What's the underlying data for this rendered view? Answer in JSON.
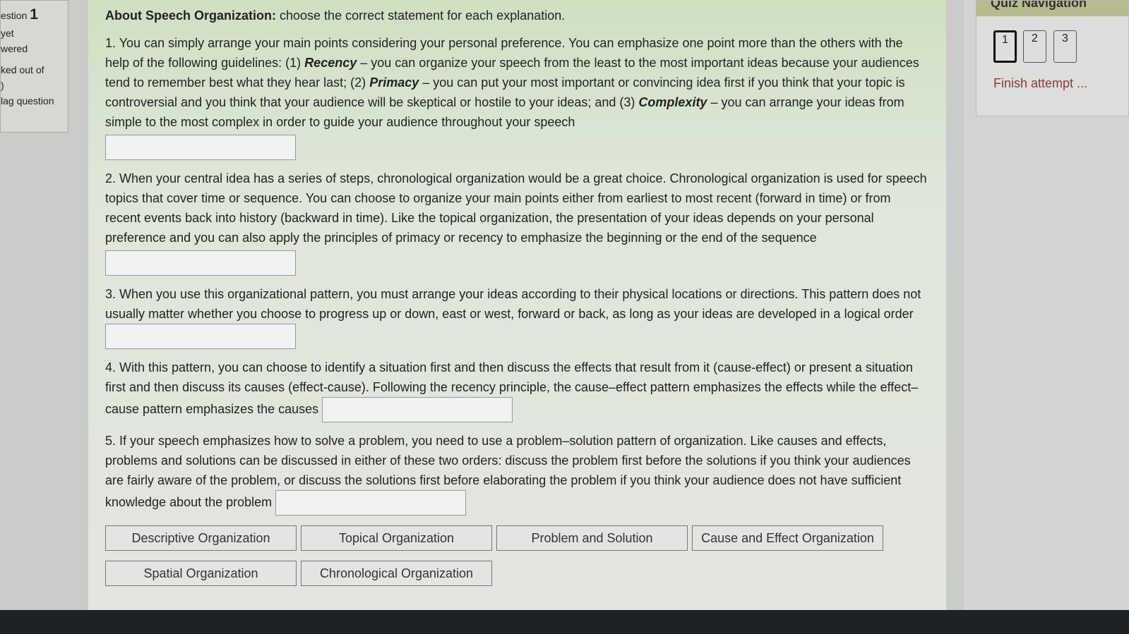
{
  "sidebar": {
    "question_label": "estion",
    "question_number": "1",
    "status_line1": "yet",
    "status_line2": "wered",
    "marked_line1": "ked out of",
    "marked_line2": ")",
    "flag": "lag question"
  },
  "main": {
    "intro_bold": "About Speech Organization:",
    "intro_rest": " choose the correct statement for each explanation.",
    "q1": {
      "a": "1. You can simply arrange your main points considering your personal preference. You can emphasize one point more than the others with the help of the following guidelines: (1) ",
      "t1": "Recency",
      "b": " – you can organize your speech from the least to the most important ideas because your audiences tend to remember best what they hear last; (2) ",
      "t2": "Primacy",
      "c": " – you can put your most important or convincing idea first if you think that your topic is controversial and you think that your audience will be skeptical or hostile to your ideas; and (3) ",
      "t3": "Complexity",
      "d": " – you can arrange your ideas from simple to the most complex in order to guide your audience throughout your speech"
    },
    "q2": "2. When your central idea has a series of steps, chronological organization would be a great choice. Chronological organization is used for speech topics that cover time or sequence. You can choose to organize your main points either from earliest to most recent (forward in time) or from recent events back into history (backward in time). Like the topical organization, the presentation of your ideas depends on your personal preference and you can also apply the principles of primacy or recency to emphasize the beginning or the end of the sequence",
    "q3": "3. When you use this organizational pattern, you must arrange your ideas according to their physical locations or directions. This pattern does not usually matter whether you choose to progress up or down, east or west, forward or back, as long as your ideas are developed in a logical order",
    "q4": "4. With this pattern, you can choose to identify a situation first and then discuss the effects that result from it (cause-effect) or present a situation first and then discuss its causes (effect-cause). Following the recency principle, the cause–effect pattern emphasizes the effects while the effect–cause pattern emphasizes the causes",
    "q5": "5. If your speech emphasizes how to solve a problem, you need to use a problem–solution pattern of organization. Like causes and effects, problems and solutions can be discussed in either of these two orders: discuss the problem first before the solutions if you think your audiences are fairly aware of the problem, or discuss the solutions first before elaborating the problem if you think your audience does not have sufficient knowledge about the problem",
    "options": [
      "Descriptive Organization",
      "Topical Organization",
      "Problem and Solution",
      "Cause and Effect Organization",
      "Spatial Organization",
      "Chronological Organization"
    ]
  },
  "nav": {
    "title": "Quiz Navigation",
    "pages": [
      "1",
      "2",
      "3"
    ],
    "current": "1",
    "finish": "Finish attempt ..."
  }
}
